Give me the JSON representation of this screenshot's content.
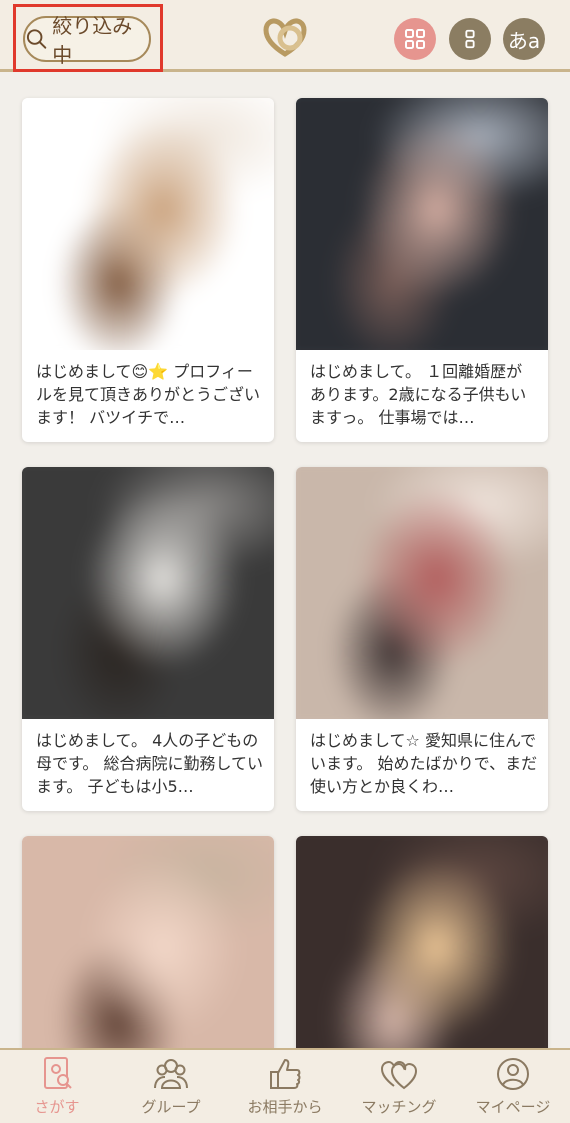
{
  "header": {
    "filter_label": "絞り込み中",
    "lang_label": "あa",
    "accent": "#e6958f",
    "brand": "#8b7d62",
    "highlight": "#e0392c"
  },
  "cards": [
    {
      "text": "はじめまして😊⭐ プロフィールを見て頂きありがとうございます！ バツイチで…",
      "palette": [
        "#ffffff",
        "#c9a07a",
        "#7a5236",
        "#efe6dc"
      ]
    },
    {
      "text": "はじめまして。 １回離婚歴があります。2歳になる子供もいますっ。 仕事場では…",
      "palette": [
        "#2b2e34",
        "#d8b0a4",
        "#7a5e58",
        "#a8b0bc"
      ]
    },
    {
      "text": "はじめまして。 4人の子どもの母です。 総合病院に勤務しています。 子どもは小5…",
      "palette": [
        "#3a3a3a",
        "#e8e6e2",
        "#2a2420",
        "#8a8886"
      ]
    },
    {
      "text": "はじめまして☆ 愛知県に住んでいます。 始めたばかりで、まだ使い方とか良くわ…",
      "palette": [
        "#c9b7aa",
        "#b25c5c",
        "#3a3030",
        "#efe4dc"
      ]
    },
    {
      "text": "",
      "palette": [
        "#d8b8a8",
        "#f2d7c8",
        "#5a3c30",
        "#c8b4a0"
      ]
    },
    {
      "text": "",
      "palette": [
        "#3a2e2c",
        "#f0c998",
        "#d8b8ac",
        "#5c4640"
      ]
    }
  ],
  "nav": [
    {
      "label": "さがす",
      "icon": "search-profile-icon",
      "active": true
    },
    {
      "label": "グループ",
      "icon": "group-icon",
      "active": false
    },
    {
      "label": "お相手から",
      "icon": "thumbs-up-icon",
      "active": false
    },
    {
      "label": "マッチング",
      "icon": "hearts-icon",
      "active": false
    },
    {
      "label": "マイページ",
      "icon": "user-icon",
      "active": false
    }
  ]
}
